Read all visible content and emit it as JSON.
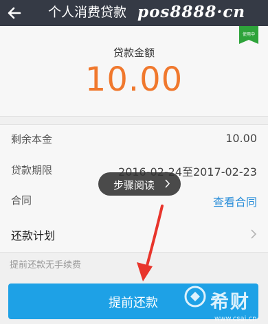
{
  "header": {
    "title": "个人消费贷款",
    "watermark": "pos8888·cn"
  },
  "loan": {
    "badge": "使用中",
    "amount_label": "贷款金额",
    "amount_value": "10.00"
  },
  "details": [
    {
      "label": "剩余本金",
      "value": "10.00"
    },
    {
      "label": "贷款期限",
      "value": "2016-02-24至2017-02-23"
    },
    {
      "label": "合同",
      "value": "查看合同"
    }
  ],
  "plan": {
    "label": "还款计划"
  },
  "note": "提前还款无手续费",
  "primary_button": "提前还款",
  "tooltip": "步骤阅读",
  "watermark_bottom": {
    "name": "希财",
    "site": "www.csai.cn"
  },
  "colors": {
    "topbar": "#353a45",
    "amount": "#f0782d",
    "badge": "#2ea33a",
    "link": "#2a8ed9",
    "primary": "#1ea1e6",
    "arrow": "#e8352c"
  }
}
